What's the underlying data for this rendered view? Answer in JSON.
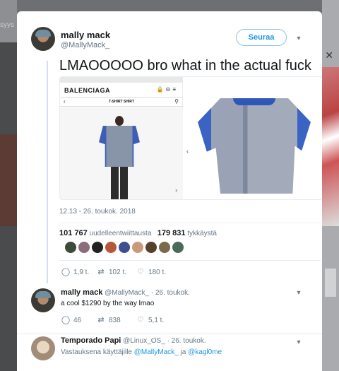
{
  "background": {
    "left_text": "syys"
  },
  "main_tweet": {
    "display_name": "mally mack",
    "handle": "@MallyMack_",
    "follow_label": "Seuraa",
    "text": "LMAOOOOO bro what in the actual fuck",
    "timestamp": "12.13 - 26. toukok. 2018",
    "retweets_count": "101 767",
    "retweets_label": "uudelleentwiittausta",
    "likes_count": "179 831",
    "likes_label": "tykkäystä",
    "media": {
      "brand": "BALENCIAGA",
      "nav_title": "T-SHIRT SHIRT"
    },
    "actions": {
      "replies": "1,9 t.",
      "retweets": "102 t.",
      "likes": "180 t."
    }
  },
  "replies": [
    {
      "display_name": "mally mack",
      "handle": "@MallyMack_",
      "date": "· 26. toukok.",
      "text": "a cool $1290 by the way lmao",
      "actions": {
        "replies": "46",
        "retweets": "838",
        "likes": "5,1 t."
      }
    },
    {
      "display_name": "Temporado Papi",
      "handle": "@Linux_OS_",
      "date": "· 26. toukok.",
      "reply_prefix": "Vastauksena käyttäjille",
      "reply_user1": "@MallyMack_",
      "reply_join": "ja",
      "reply_user2": "@kagl0me"
    }
  ],
  "colors": {
    "accent": "#1b95e0",
    "muted": "#657786",
    "text": "#14171a"
  },
  "icons": [
    "chevron-down-icon",
    "reply-icon",
    "retweet-icon",
    "heart-icon",
    "search-icon",
    "back-arrow-icon"
  ]
}
